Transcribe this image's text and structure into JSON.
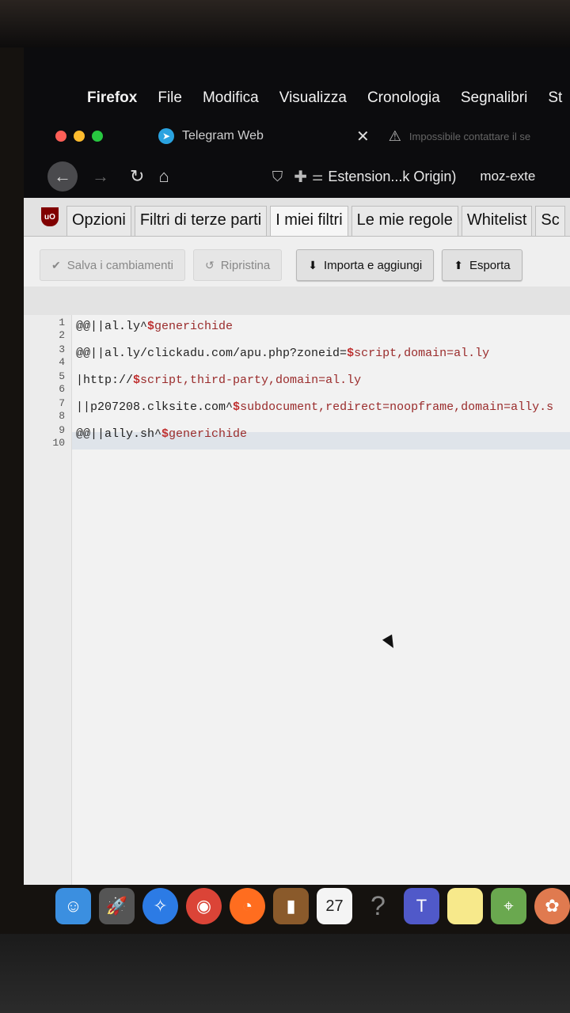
{
  "menubar": {
    "app": "Firefox",
    "items": [
      "File",
      "Modifica",
      "Visualizza",
      "Cronologia",
      "Segnalibri",
      "St"
    ]
  },
  "tabs": {
    "telegram_label": "Telegram Web",
    "warning_label": "Impossibile contattare il se"
  },
  "navbar": {
    "url_label": "Estension...k Origin)",
    "url_extra": "moz-exte"
  },
  "ublock": {
    "logo": "uO",
    "tabs": [
      "Opzioni",
      "Filtri di terze parti",
      "I miei filtri",
      "Le mie regole",
      "Whitelist",
      "Sc"
    ],
    "active_tab": "I miei filtri",
    "buttons": {
      "save": "Salva i cambiamenti",
      "revert": "Ripristina",
      "import": "Importa e aggiungi",
      "export": "Esporta"
    }
  },
  "editor": {
    "line_numbers": [
      "1",
      "2",
      "3",
      "4",
      "5",
      "6",
      "7",
      "8",
      "9",
      "10"
    ],
    "lines": [
      "@@||al.ly^$generichide",
      "@@||al.ly/clickadu.com/apu.php?zoneid=$script,domain=al.ly",
      "|http://$script,third-party,domain=al.ly",
      "||p207208.clksite.com^$subdocument,redirect=noopframe,domain=ally.s",
      "@@||ally.sh^$generichide"
    ]
  },
  "dock": {
    "calendar_day": "27"
  },
  "colors": {
    "dollar": "#c03030",
    "active_line": "#dfe4ea",
    "ublock_logo": "#800000"
  }
}
